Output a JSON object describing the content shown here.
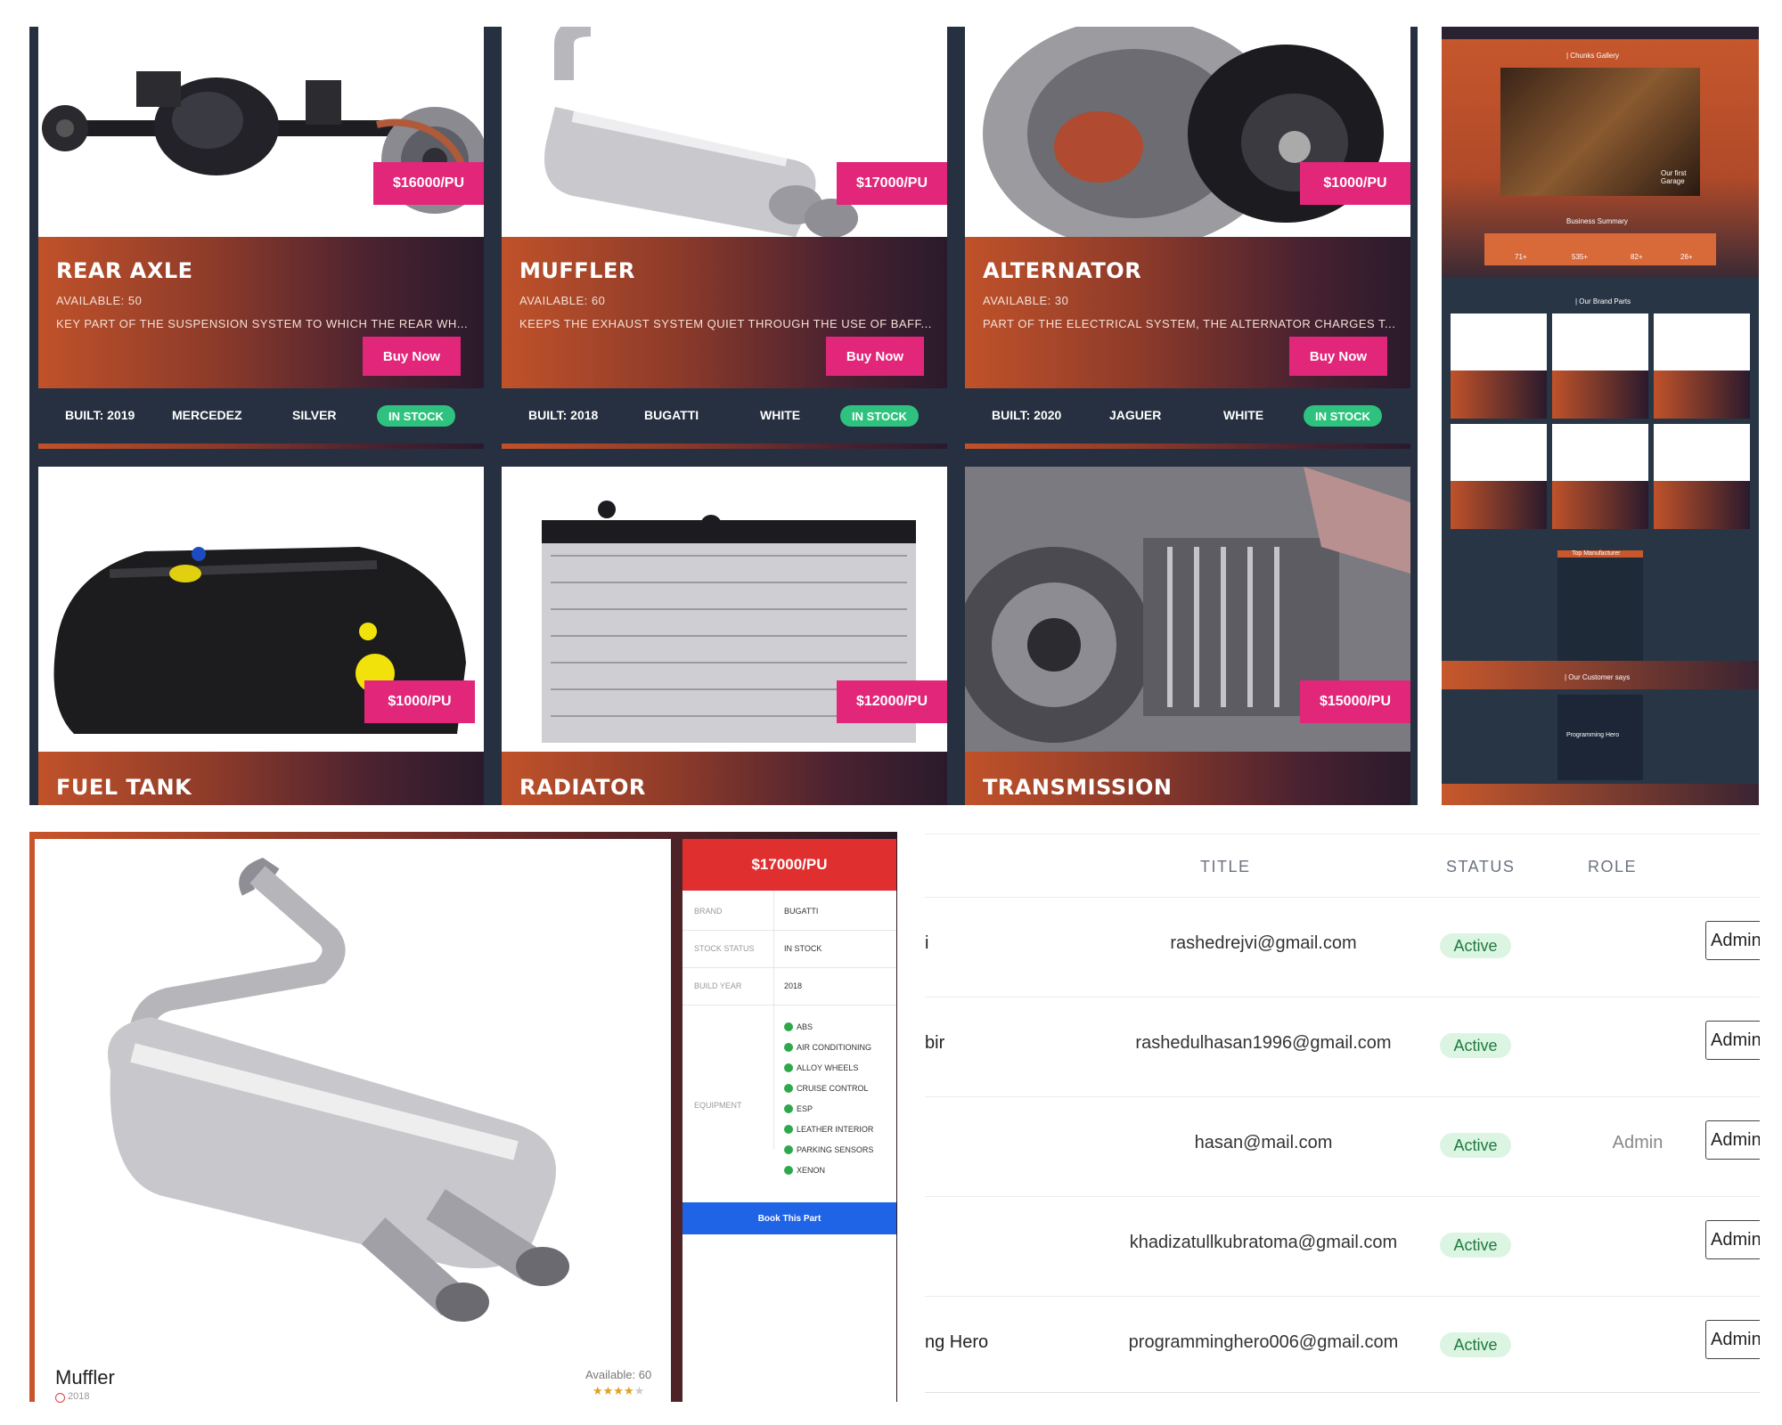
{
  "products": [
    {
      "name": "REAR AXLE",
      "price": "$16000/PU",
      "available": "AVAILABLE: 50",
      "description": "KEY PART OF THE SUSPENSION SYSTEM TO WHICH THE REAR WH...",
      "buy": "Buy Now",
      "built": "BUILT: 2019",
      "brand": "MERCEDEZ",
      "color": "SILVER",
      "stock": "IN STOCK"
    },
    {
      "name": "MUFFLER",
      "price": "$17000/PU",
      "available": "AVAILABLE: 60",
      "description": "KEEPS THE EXHAUST SYSTEM QUIET THROUGH THE USE OF BAFF...",
      "buy": "Buy Now",
      "built": "BUILT: 2018",
      "brand": "BUGATTI",
      "color": "WHITE",
      "stock": "IN STOCK"
    },
    {
      "name": "ALTERNATOR",
      "price": "$1000/PU",
      "available": "AVAILABLE: 30",
      "description": "PART OF THE ELECTRICAL SYSTEM, THE ALTERNATOR CHARGES T...",
      "buy": "Buy Now",
      "built": "BUILT: 2020",
      "brand": "JAGUER",
      "color": "WHITE",
      "stock": "IN STOCK"
    },
    {
      "name": "FUEL TANK",
      "price": "$1000/PU"
    },
    {
      "name": "RADIATOR",
      "price": "$12000/PU"
    },
    {
      "name": "TRANSMISSION",
      "price": "$15000/PU"
    }
  ],
  "mini": {
    "gallery_title": "| Chunks Gallery",
    "garage_caption": "Our first Garage",
    "summary_title": "Business Summary",
    "summary_values": [
      "71+",
      "535+",
      "82+",
      "26+"
    ],
    "parts_title": "| Our Brand Parts",
    "manufacturers_title": "Top Manufacturer",
    "customers_title": "| Our Customer says",
    "customer_name": "Programming Hero"
  },
  "detail": {
    "name": "Muffler",
    "year": "2018",
    "available": "Available: 60",
    "price": "$17000/PU",
    "specs": [
      {
        "key": "BRAND",
        "value": "BUGATTI"
      },
      {
        "key": "STOCK STATUS",
        "value": "IN STOCK"
      },
      {
        "key": "BUILD YEAR",
        "value": "2018"
      }
    ],
    "equipment_label": "EQUIPMENT",
    "equipment": [
      "ABS",
      "AIR CONDITIONING",
      "ALLOY WHEELS",
      "CRUISE CONTROL",
      "ESP",
      "LEATHER INTERIOR",
      "PARKING SENSORS",
      "XENON"
    ],
    "book": "Book This Part"
  },
  "table": {
    "headers": {
      "title": "TITLE",
      "status": "STATUS",
      "role": "ROLE"
    },
    "rows": [
      {
        "name": "i",
        "email": "rashedrejvi@gmail.com",
        "status": "Active",
        "role": "",
        "action": "Admin"
      },
      {
        "name": "bir",
        "email": "rashedulhasan1996@gmail.com",
        "status": "Active",
        "role": "",
        "action": "Admin"
      },
      {
        "name": "",
        "email": "hasan@mail.com",
        "status": "Active",
        "role": "Admin",
        "action": "Admin"
      },
      {
        "name": "",
        "email": "khadizatullkubratoma@gmail.com",
        "status": "Active",
        "role": "",
        "action": "Admin"
      },
      {
        "name": "ng Hero",
        "email": "programminghero006@gmail.com",
        "status": "Active",
        "role": "",
        "action": "Admin"
      }
    ]
  },
  "colors": {
    "accent": "#e2267a",
    "navy": "#263040",
    "stock_green": "#2ec27e",
    "detail_red": "#e02f2f",
    "book_blue": "#1f63e6"
  }
}
